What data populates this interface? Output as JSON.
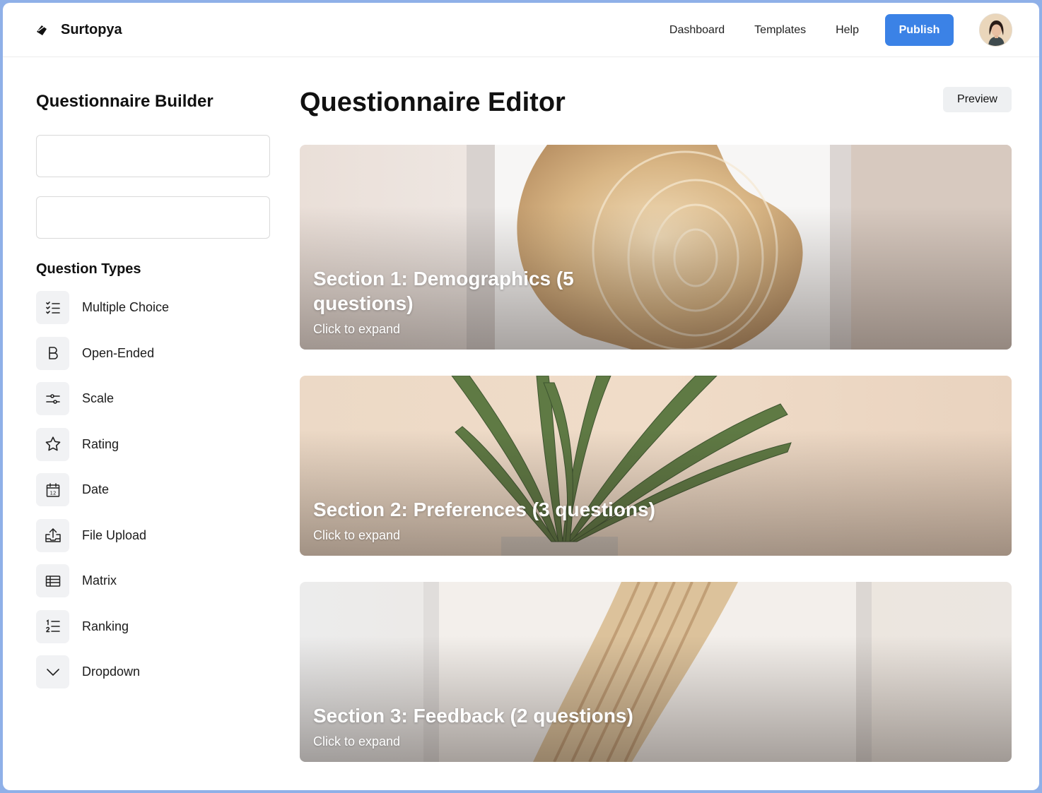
{
  "app": {
    "name": "Surtopya"
  },
  "nav": {
    "links": [
      "Dashboard",
      "Templates",
      "Help"
    ],
    "publish_label": "Publish"
  },
  "sidebar": {
    "title": "Questionnaire Builder",
    "inputs": [
      {
        "value": "",
        "placeholder": ""
      },
      {
        "value": "",
        "placeholder": ""
      }
    ],
    "question_types_title": "Question Types",
    "question_types": [
      {
        "label": "Multiple Choice",
        "icon": "list-checks-icon"
      },
      {
        "label": "Open-Ended",
        "icon": "bold-b-icon"
      },
      {
        "label": "Scale",
        "icon": "sliders-icon"
      },
      {
        "label": "Rating",
        "icon": "star-icon"
      },
      {
        "label": "Date",
        "icon": "calendar-icon"
      },
      {
        "label": "File Upload",
        "icon": "upload-icon"
      },
      {
        "label": "Matrix",
        "icon": "table-icon"
      },
      {
        "label": "Ranking",
        "icon": "ordered-list-icon"
      },
      {
        "label": "Dropdown",
        "icon": "chevron-down-icon"
      }
    ]
  },
  "main": {
    "title": "Questionnaire Editor",
    "preview_label": "Preview",
    "sections": [
      {
        "title": "Section 1: Demographics (5 questions)",
        "subtitle": "Click to expand"
      },
      {
        "title": "Section 2: Preferences (3 questions)",
        "subtitle": "Click to expand"
      },
      {
        "title": "Section 3: Feedback (2 questions)",
        "subtitle": "Click to expand"
      }
    ]
  },
  "colors": {
    "accent": "#3b82e6",
    "icon_bg": "#f1f2f4"
  }
}
